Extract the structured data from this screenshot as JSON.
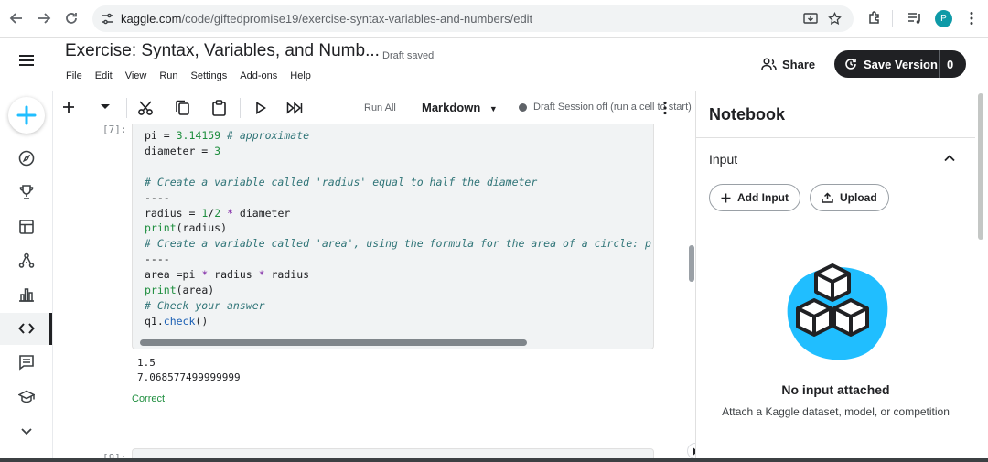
{
  "browser": {
    "url_host": "kaggle.com",
    "url_path": "/code/giftedpromise19/exercise-syntax-variables-and-numbers/edit",
    "profile_initial": "P"
  },
  "header": {
    "title": "Exercise: Syntax, Variables, and Numb...",
    "draft_status": "Draft saved",
    "menus": [
      "File",
      "Edit",
      "View",
      "Run",
      "Settings",
      "Add-ons",
      "Help"
    ],
    "share_label": "Share",
    "save_version_label": "Save Version",
    "save_version_count": "0"
  },
  "toolbar": {
    "run_all_label": "Run All",
    "cell_type": "Markdown",
    "session_status": "Draft Session off (run a cell to start)"
  },
  "cell": {
    "exec_count": "[7]:",
    "lines": [
      "pi = 3.14159 # approximate",
      "diameter = 3",
      "",
      "# Create a variable called 'radius' equal to half the diameter",
      "----",
      "radius = 1/2 * diameter",
      "print(radius)",
      "# Create a variable called 'area', using the formula for the area of a circle: p",
      "----",
      "area =pi * radius * radius",
      "print(area)",
      "# Check your answer",
      "q1.check()"
    ],
    "output": [
      "1.5",
      "7.068577499999999"
    ],
    "result": "Correct",
    "next_exec_count": "[8]:"
  },
  "panel": {
    "title": "Notebook",
    "section": "Input",
    "add_input_label": "Add Input",
    "upload_label": "Upload",
    "empty_title": "No input attached",
    "empty_subtitle": "Attach a Kaggle dataset, model, or competition"
  },
  "colors": {
    "accent": "#20beff",
    "dark_button": "#202124",
    "correct": "#1e8e3e"
  },
  "icons": [
    "back-icon",
    "forward-icon",
    "reload-icon",
    "site-settings-icon",
    "install-icon",
    "bookmark-star-icon",
    "extensions-icon",
    "media-icon",
    "kebab-menu-icon",
    "hamburger-icon",
    "plus-icon",
    "compass-icon",
    "trophy-icon",
    "table-icon",
    "models-icon",
    "bar-chart-icon",
    "code-icon",
    "comments-icon",
    "school-icon",
    "chevron-down-icon",
    "cut-icon",
    "copy-icon",
    "paste-icon",
    "run-icon",
    "run-all-icon",
    "share-icon",
    "save-version-icon",
    "chevron-up-icon",
    "upload-icon",
    "cubes-icon"
  ]
}
